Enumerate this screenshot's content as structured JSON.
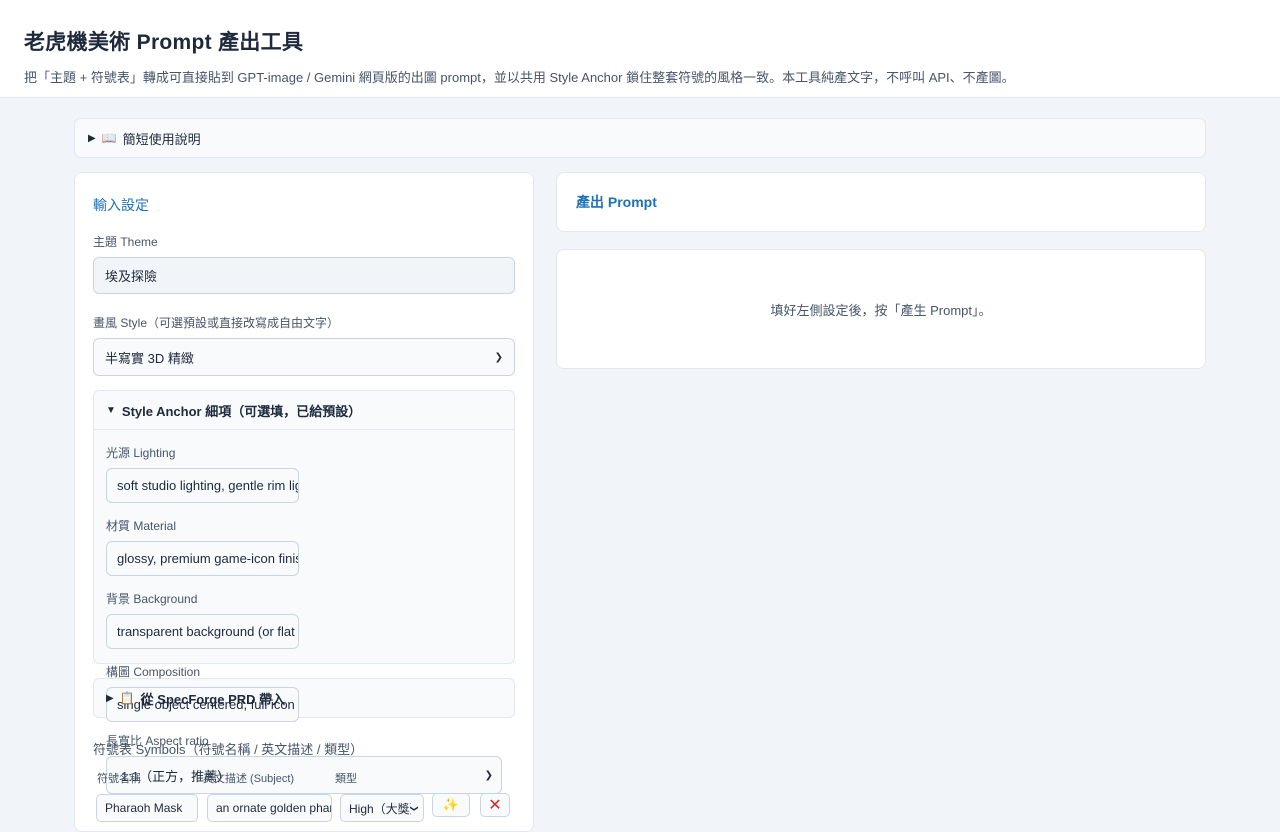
{
  "header": {
    "title": "老虎機美術 Prompt 產出工具",
    "subtitle": "把「主題 + 符號表」轉成可直接貼到 GPT-image / Gemini 網頁版的出圖 prompt，並以共用 Style Anchor 鎖住整套符號的風格一致。本工具純產文字，不呼叫 API、不產圖。"
  },
  "help": {
    "label": "簡短使用說明",
    "icon": "book-icon"
  },
  "input_panel": {
    "title": "輸入設定",
    "theme_label": "主題 Theme",
    "theme_value": "埃及探險",
    "style_label": "畫風 Style（可選預設或直接改寫成自由文字）",
    "style_value": "半寫實 3D 精緻",
    "anchor": {
      "title": "Style Anchor 細項（可選填，已給預設）",
      "lighting_label": "光源 Lighting",
      "lighting_value": "soft studio lighting, gentle rim light",
      "material_label": "材質 Material",
      "material_value": "glossy, premium game-icon finish",
      "background_label": "背景 Background",
      "background_value": "transparent background (or flat color)",
      "composition_label": "構圖 Composition",
      "composition_value": "single object centered, full icon",
      "aspect_label": "長寬比 Aspect ratio",
      "aspect_value": "1:1（正方，推薦）"
    },
    "prd_label": "從 SpecForge PRD 帶入",
    "prd_icon": "clipboard-icon",
    "symbols_label": "符號表 Symbols（符號名稱 / 英文描述 / 類型）",
    "symbols_headers": [
      "符號名稱",
      "英文描述 (Subject)",
      "類型"
    ],
    "symbols": [
      {
        "name": "Pharaoh Mask",
        "subject": "an ornate golden pharaoh mask",
        "type": "High（大獎）"
      }
    ]
  },
  "output_panel": {
    "title": "產出 Prompt",
    "placeholder": "填好左側設定後，按「產生 Prompt」。"
  },
  "colors": {
    "accent": "#1d72b8",
    "delete": "#dc2626"
  }
}
